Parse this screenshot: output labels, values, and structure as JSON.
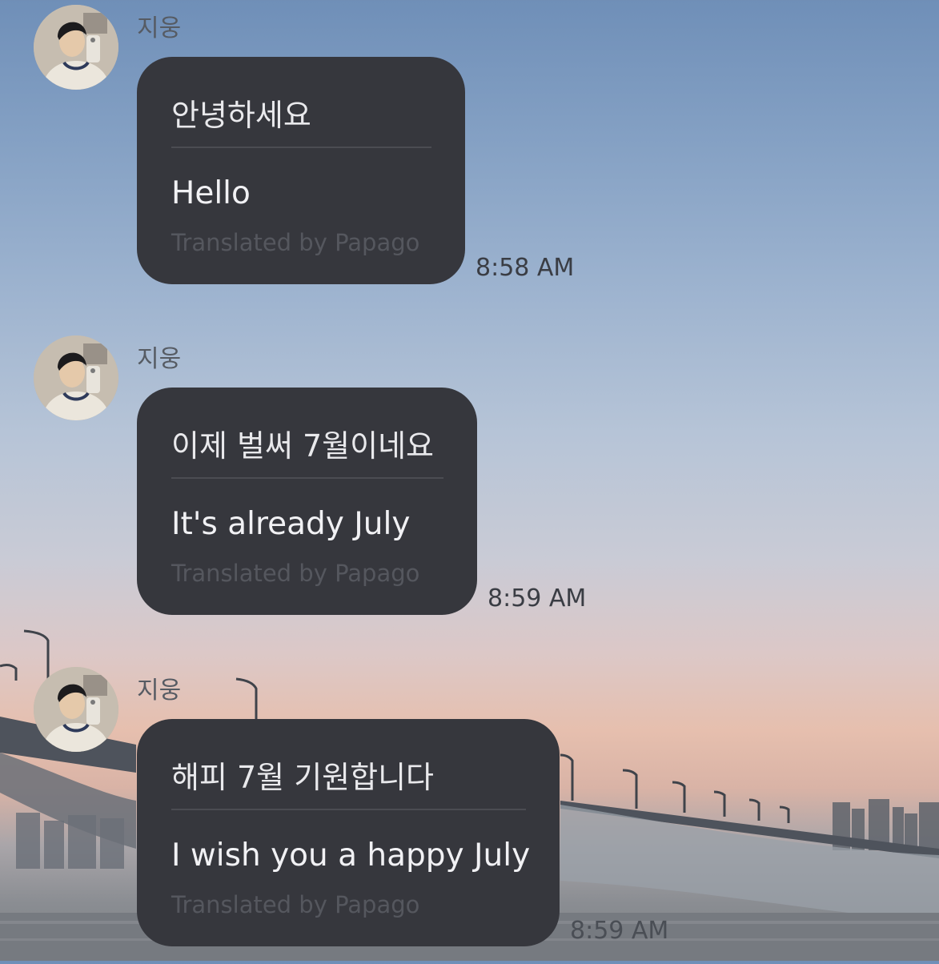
{
  "messages": [
    {
      "sender": "지웅",
      "original": "안녕하세요",
      "translation": "Hello",
      "credit": "Translated by Papago",
      "time": "8:58 AM"
    },
    {
      "sender": "지웅",
      "original": "이제 벌써 7월이네요",
      "translation": "It's already July",
      "credit": "Translated by Papago",
      "time": "8:59 AM"
    },
    {
      "sender": "지웅",
      "original": "해피 7월 기원합니다",
      "translation": "I wish you a happy July",
      "credit": "Translated by Papago",
      "time": "8:59 AM"
    }
  ],
  "colors": {
    "bubble": "#36373d",
    "sender_text": "#565b63",
    "credit_text": "#55575e"
  },
  "icons": {
    "avatar": "profile-photo"
  }
}
